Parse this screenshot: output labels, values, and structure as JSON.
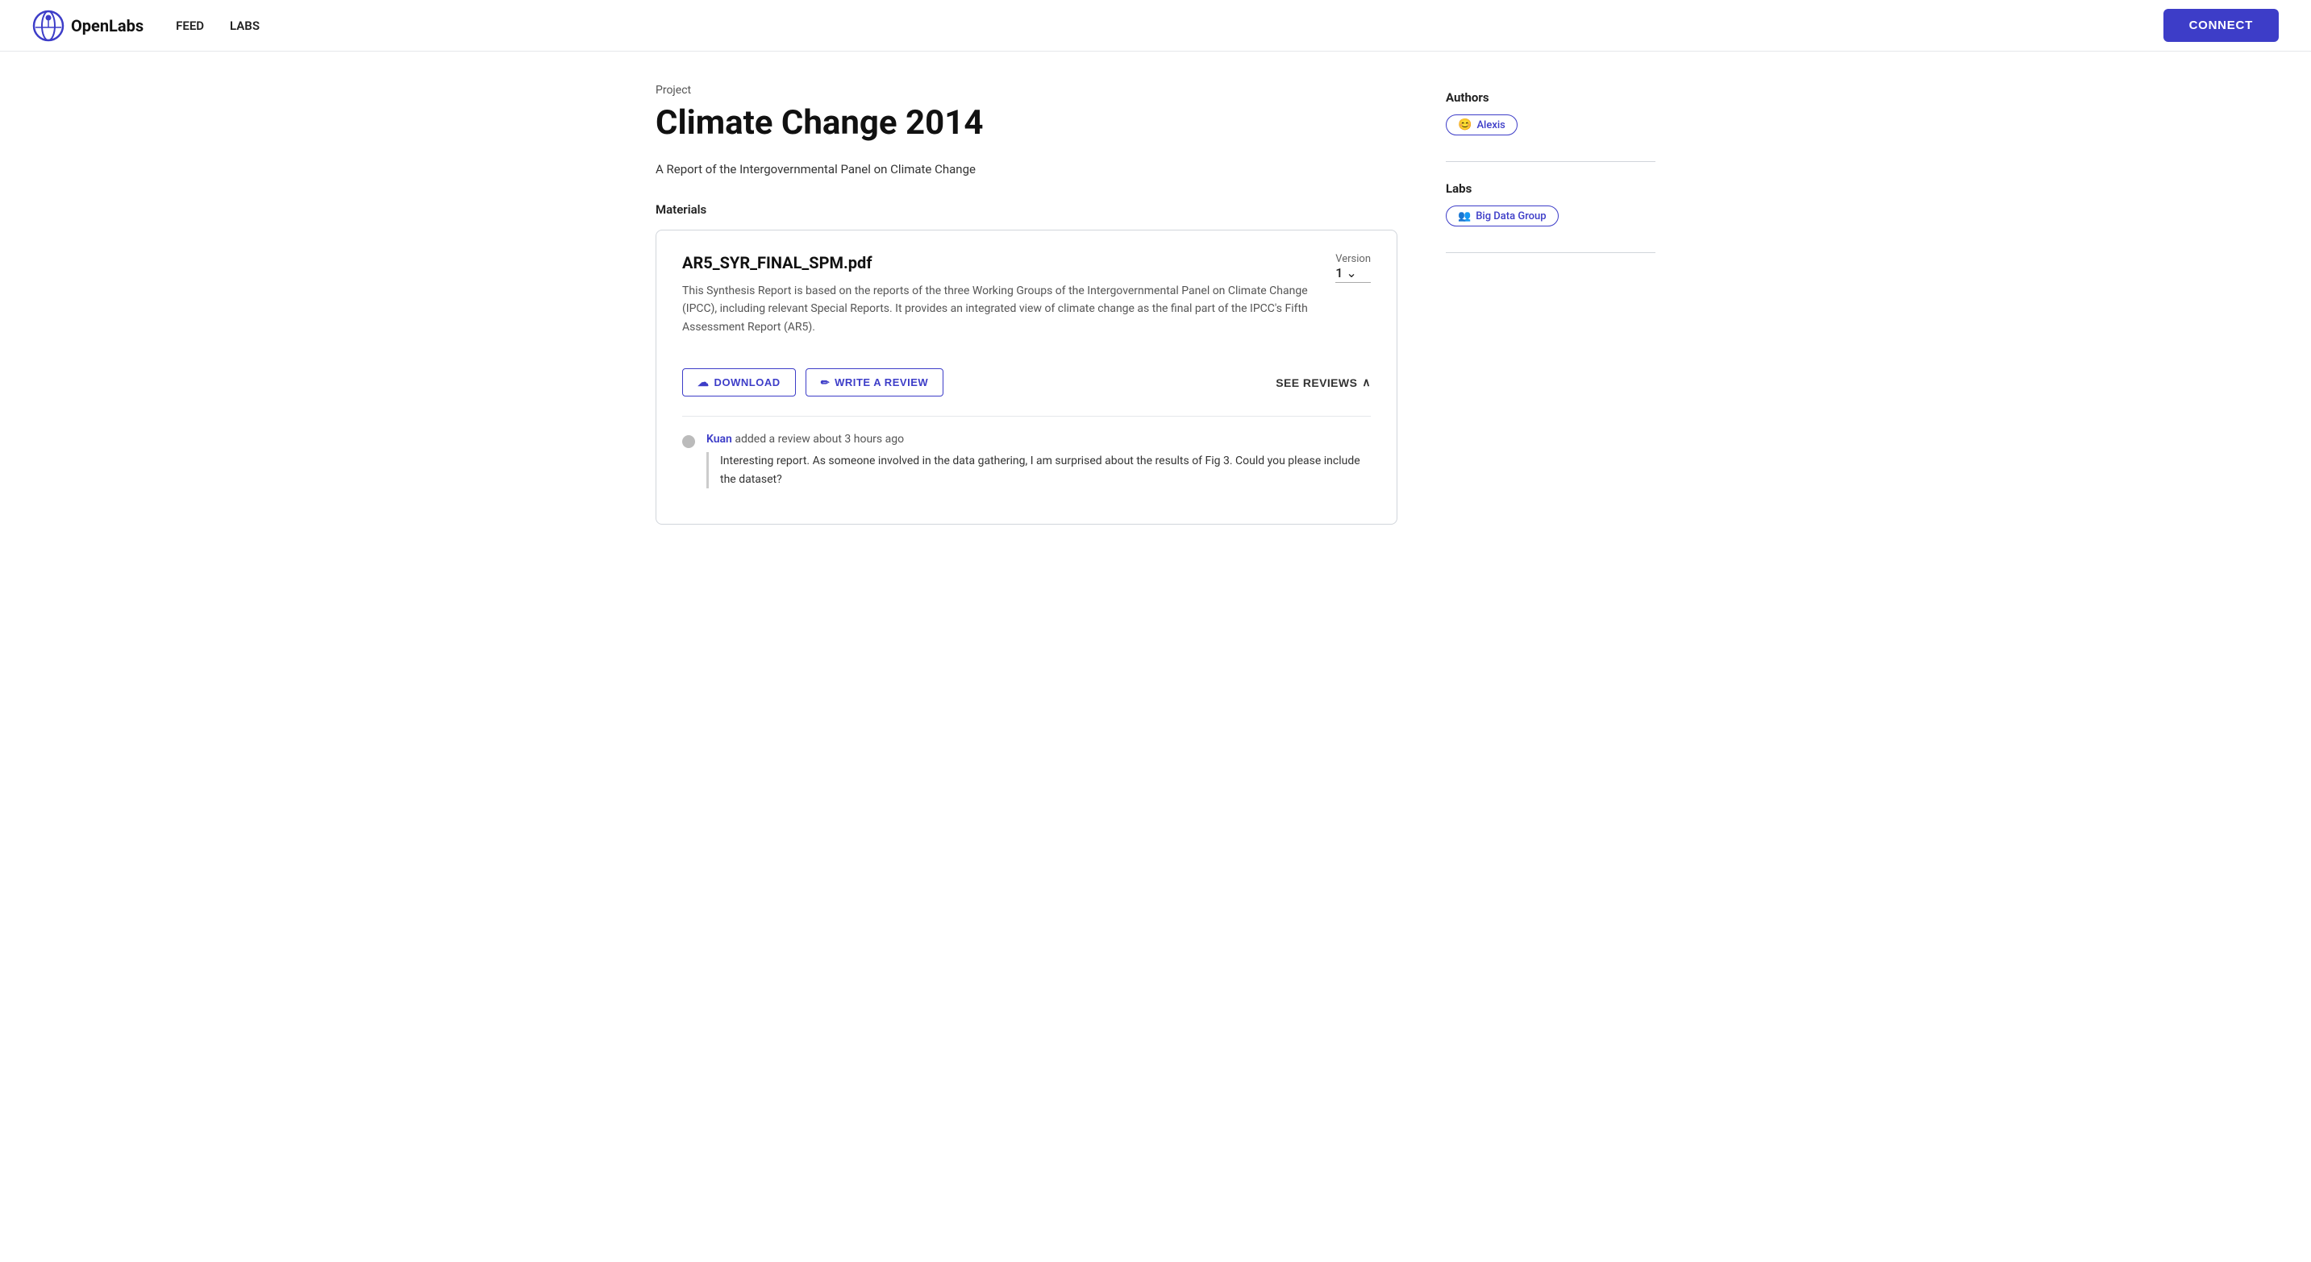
{
  "nav": {
    "logo_text": "OpenLabs",
    "links": [
      "FEED",
      "LABS"
    ],
    "connect_label": "CONNECT"
  },
  "project": {
    "label": "Project",
    "title": "Climate Change 2014",
    "subtitle": "A Report of the Intergovernmental Panel on Climate Change",
    "materials_label": "Materials"
  },
  "material": {
    "filename": "AR5_SYR_FINAL_SPM.pdf",
    "description": "This Synthesis Report is based on the reports of the three Working Groups of the Intergovernmental Panel on Climate Change (IPCC), including relevant Special Reports. It provides an integrated view of climate change as the final part of the IPCC's Fifth Assessment Report (AR5).",
    "version_label": "Version",
    "version_value": "1",
    "download_label": "DOWNLOAD",
    "write_review_label": "WRITE A REVIEW",
    "see_reviews_label": "SEE REVIEWS"
  },
  "reviews": [
    {
      "author": "Kuan",
      "meta_suffix": "added a review about 3 hours ago",
      "text": "Interesting report. As someone involved in the data gathering, I am surprised about the results of Fig 3. Could you please include the dataset?"
    }
  ],
  "sidebar": {
    "authors_label": "Authors",
    "authors": [
      {
        "name": "Alexis"
      }
    ],
    "labs_label": "Labs",
    "labs": [
      {
        "name": "Big Data Group"
      }
    ]
  }
}
